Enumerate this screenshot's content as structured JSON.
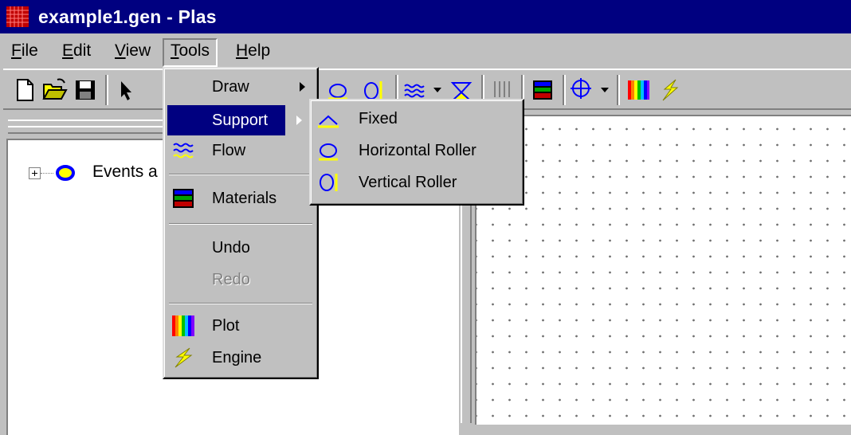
{
  "window": {
    "title": "example1.gen - Plas"
  },
  "menubar": [
    {
      "label": "File",
      "key": "F",
      "rest": "ile"
    },
    {
      "label": "Edit",
      "key": "E",
      "rest": "dit"
    },
    {
      "label": "View",
      "key": "V",
      "rest": "iew"
    },
    {
      "label": "Tools",
      "key": "T",
      "rest": "ools"
    },
    {
      "label": "Help",
      "key": "H",
      "rest": "elp"
    }
  ],
  "tree": {
    "root_label": "Events a"
  },
  "tools_menu": {
    "draw": "Draw",
    "support": "Support",
    "flow": "Flow",
    "materials": "Materials",
    "undo": "Undo",
    "redo": "Redo",
    "plot": "Plot",
    "engine": "Engine"
  },
  "support_submenu": {
    "fixed": "Fixed",
    "horizontal_roller": "Horizontal Roller",
    "vertical_roller": "Vertical Roller"
  },
  "colors": {
    "titlebar": "#000080",
    "highlight": "#000080",
    "face": "#c0c0c0",
    "icon_blue": "#0000ff",
    "icon_yellow": "#ffff00"
  }
}
